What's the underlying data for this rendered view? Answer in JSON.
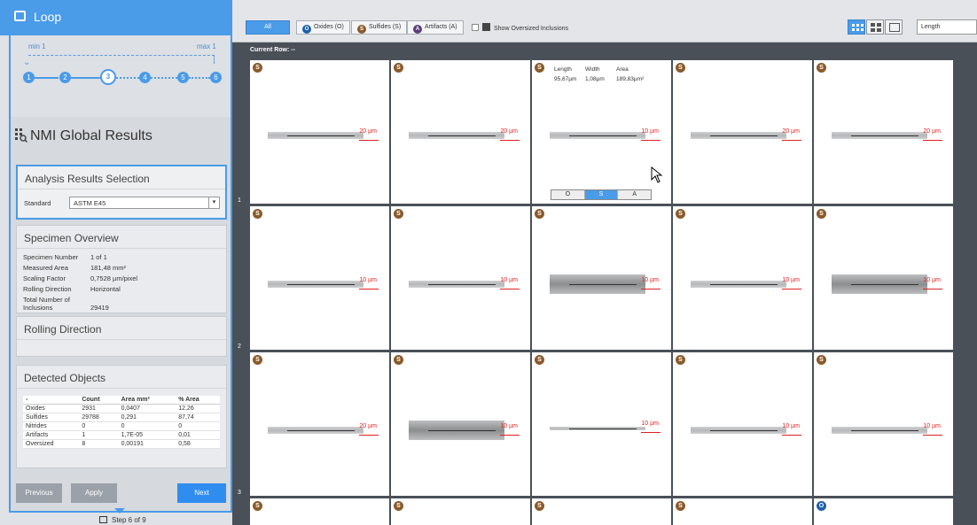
{
  "loop": {
    "title": "Loop"
  },
  "stepper": {
    "min_label": "min 1",
    "max_label": "max 1",
    "steps": [
      "1",
      "2",
      "3",
      "4",
      "5",
      "6"
    ],
    "active_index": 2
  },
  "results": {
    "title": "NMI Global Results"
  },
  "analysis": {
    "title": "Analysis Results Selection",
    "standard_label": "Standard",
    "standard_value": "ASTM E45"
  },
  "specimen": {
    "title": "Specimen Overview",
    "rows": [
      {
        "k": "Specimen Number",
        "v": "1 of 1"
      },
      {
        "k": "Measured Area",
        "v": "181,48 mm²"
      },
      {
        "k": "Scaling Factor",
        "v": "0,7528 µm/pixel"
      },
      {
        "k": "Rolling Direction",
        "v": "Horizontal"
      },
      {
        "k": "Total Number of Inclusions",
        "v": "29419"
      }
    ]
  },
  "rolling": {
    "title": "Rolling Direction"
  },
  "detected": {
    "title": "Detected Objects",
    "headers": [
      "-",
      "Count",
      "Area mm²",
      "% Area"
    ],
    "rows": [
      [
        "Oxides",
        "2931",
        "0,0407",
        "12,26"
      ],
      [
        "Sulfides",
        "29788",
        "0,291",
        "87,74"
      ],
      [
        "Nitrides",
        "0",
        "0",
        "0"
      ],
      [
        "Artifacts",
        "1",
        "1,7E-05",
        "0,01"
      ],
      [
        "Oversized",
        "8",
        "0,00191",
        "0,58"
      ]
    ]
  },
  "nav": {
    "previous": "Previous",
    "apply": "Apply",
    "next": "Next",
    "step_text": "Step 6 of 9"
  },
  "toolbar": {
    "all": "All",
    "oxides": "Oxides (O)",
    "sulfides": "Sulfides (S)",
    "artifacts": "Artifacts (A)",
    "show_oversized": "Show Oversized Inclusions",
    "sort_value": "Length"
  },
  "grid": {
    "current_row": "Current Row: --",
    "row_labels": [
      "1",
      "2",
      "3"
    ],
    "info": {
      "length_label": "Length",
      "width_label": "Width",
      "area_label": "Area",
      "length": "95,67µm",
      "width": "1,08µm",
      "area": "189,83µm²"
    },
    "segment": [
      "O",
      "S",
      "A"
    ],
    "scale_20": "20 µm",
    "scale_10": "10 µm",
    "badge_s": "S",
    "badge_o": "O"
  }
}
